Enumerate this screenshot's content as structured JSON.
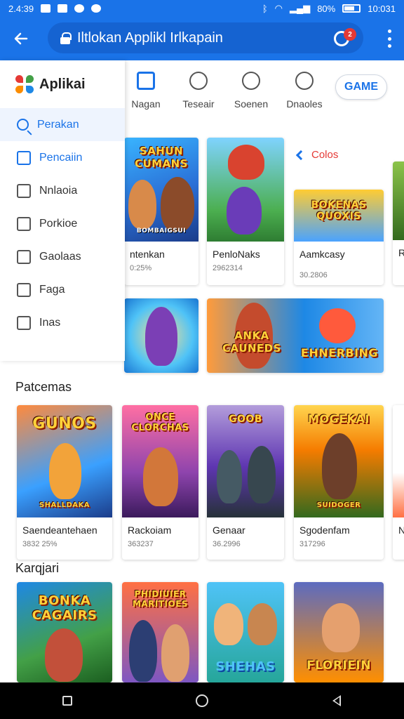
{
  "status_bar": {
    "time_left": "2.4:39",
    "battery_text": "80%",
    "time_right": "10:031"
  },
  "app_bar": {
    "search_text": "Iltlokan Applikl Irlkapain",
    "mic_badge": "2",
    "icons": [
      "back-arrow-icon",
      "lock-icon",
      "mic-icon",
      "more-vert-icon"
    ]
  },
  "drawer": {
    "title": "Aplikai",
    "items": [
      {
        "label": "Perakan",
        "icon": "search-icon"
      },
      {
        "label": "Pencaiin",
        "icon": "inbox-icon"
      },
      {
        "label": "Nnlaoia",
        "icon": "notification-icon"
      },
      {
        "label": "Porkioe",
        "icon": "bookmark-icon"
      },
      {
        "label": "Gaolaas",
        "icon": "note-icon"
      },
      {
        "label": "Faga",
        "icon": "puzzle-icon"
      },
      {
        "label": "Inas",
        "icon": "image-icon"
      }
    ]
  },
  "categories": [
    {
      "label": "Nagan",
      "icon": "apps-icon"
    },
    {
      "label": "Teseair",
      "icon": "bell-icon"
    },
    {
      "label": "Soenen",
      "icon": "face-icon"
    },
    {
      "label": "Dnaoles",
      "icon": "search-icon"
    }
  ],
  "game_chip": "GAME",
  "colos_link": "Colos",
  "row1": [
    {
      "art_title": "SAHUN CUMANS",
      "art_sub": "BOMBAIGSUI",
      "name": "ntenkan",
      "sub": "0:25%"
    },
    {
      "art_title": "",
      "name": "PenloNaks",
      "sub": "2962314"
    },
    {
      "art_title": "BOKENAS QUOXIS",
      "name": "Aamkcasy",
      "sub": "30.2806"
    },
    {
      "art_title": "",
      "name": "Ra",
      "sub": ""
    }
  ],
  "row2": [
    {
      "art_title": ""
    },
    {
      "art_title": "ANKA CAUNEDS",
      "art_title2": "EHNERBING"
    }
  ],
  "sections": {
    "popular": "Patcemas",
    "categories": "Karqjari"
  },
  "popular_cards": [
    {
      "art_title": "GUNOS",
      "art_sub": "SHALLDAKA",
      "name": "Saendeantehaen",
      "sub": "3832 25%"
    },
    {
      "art_title": "ONCE CLORCHAS",
      "name": "Rackoiam",
      "sub": "363237"
    },
    {
      "art_title": "GOOB",
      "name": "Genaar",
      "sub": "36.2996"
    },
    {
      "art_title": "MOGEKAI",
      "art_sub": "SUIDOGER",
      "name": "Sgodenfam",
      "sub": "317296"
    },
    {
      "art_title": "",
      "name": "Nc",
      "sub": ""
    }
  ],
  "category_cards": [
    {
      "art_title": "BONKA CAGAIRS"
    },
    {
      "art_title": "PHIDIUIER MARITIOES"
    },
    {
      "art_title": "SHEHAS"
    },
    {
      "art_title": "FLORIEIN"
    }
  ]
}
